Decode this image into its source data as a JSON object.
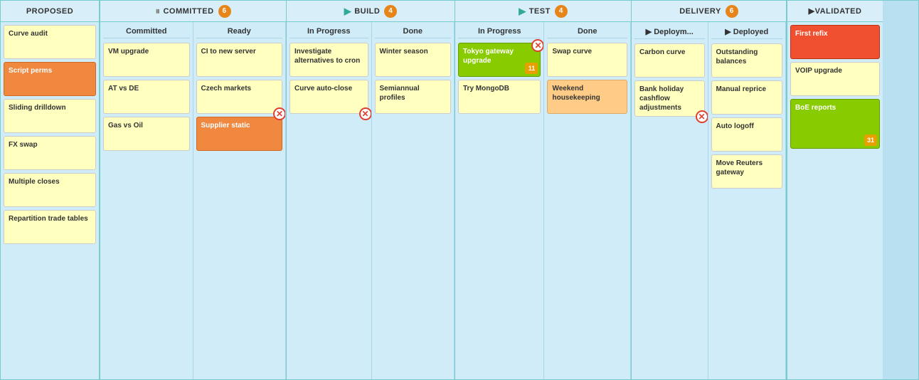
{
  "board": {
    "columns": [
      {
        "id": "proposed",
        "label": "PROPOSED",
        "type": "single",
        "width": 140,
        "cards": [
          {
            "title": "Curve audit",
            "color": "yellow"
          },
          {
            "title": "Script perms",
            "color": "orange"
          },
          {
            "title": "Sliding drilldown",
            "color": "yellow"
          },
          {
            "title": "FX swap",
            "color": "yellow"
          },
          {
            "title": "Multiple closes",
            "color": "yellow"
          },
          {
            "title": "Repartition trade tables",
            "color": "yellow"
          }
        ]
      },
      {
        "id": "committed",
        "label": "COMMITTED",
        "badge": "6",
        "pause": true,
        "lanes": [
          {
            "id": "committed-committed",
            "label": "Committed",
            "width": 130,
            "cards": [
              {
                "title": "VM upgrade",
                "color": "yellow"
              },
              {
                "title": "AT vs DE",
                "color": "yellow"
              },
              {
                "title": "Gas vs Oil",
                "color": "yellow"
              }
            ],
            "deleteBtn": false
          },
          {
            "id": "committed-ready",
            "label": "Ready",
            "width": 130,
            "cards": [
              {
                "title": "CI to new server",
                "color": "yellow"
              },
              {
                "title": "Czech markets",
                "color": "yellow"
              },
              {
                "title": "Supplier static",
                "color": "orange"
              }
            ],
            "deleteBtn": true
          }
        ]
      },
      {
        "id": "build",
        "label": "BUILD",
        "badge": "4",
        "arrow": true,
        "lanes": [
          {
            "id": "build-inprogress",
            "label": "In Progress",
            "width": 120,
            "cards": [
              {
                "title": "Investigate alternatives to cron",
                "color": "yellow"
              },
              {
                "title": "Curve auto-close",
                "color": "yellow"
              }
            ],
            "deleteBtn": true
          },
          {
            "id": "build-done",
            "label": "Done",
            "width": 115,
            "cards": [
              {
                "title": "Winter season",
                "color": "yellow"
              },
              {
                "title": "Semiannual profiles",
                "color": "yellow"
              }
            ],
            "deleteBtn": false
          }
        ]
      },
      {
        "id": "test",
        "label": "TEST",
        "badge": "4",
        "arrow": true,
        "lanes": [
          {
            "id": "test-inprogress",
            "label": "In Progress",
            "width": 125,
            "cards": [
              {
                "title": "Tokyo gateway upgrade",
                "color": "green",
                "badge": "11",
                "deleteBtn": true
              },
              {
                "title": "Try MongoDB",
                "color": "yellow"
              }
            ],
            "deleteBtn": false
          },
          {
            "id": "test-done",
            "label": "Done",
            "width": 120,
            "cards": [
              {
                "title": "Swap curve",
                "color": "yellow"
              },
              {
                "title": "Weekend housekeeping",
                "color": "light-orange"
              }
            ],
            "deleteBtn": false
          }
        ]
      },
      {
        "id": "delivery",
        "label": "DELIVERY",
        "badge": "6",
        "arrow": true,
        "lanes": [
          {
            "id": "delivery-deploym",
            "label": "Deploym...",
            "width": 105,
            "cards": [
              {
                "title": "Carbon curve",
                "color": "yellow"
              },
              {
                "title": "Bank holiday cashflow adjustments",
                "color": "yellow"
              }
            ],
            "deleteBtn": true
          },
          {
            "id": "delivery-deployed",
            "label": "Deployed",
            "width": 110,
            "arrow": true,
            "cards": [
              {
                "title": "Outstanding balances",
                "color": "yellow"
              },
              {
                "title": "Manual reprice",
                "color": "yellow"
              },
              {
                "title": "Auto logoff",
                "color": "yellow"
              },
              {
                "title": "Move Reuters gateway",
                "color": "yellow"
              }
            ],
            "deleteBtn": false
          }
        ]
      },
      {
        "id": "validated",
        "label": "VALIDATED",
        "arrow": true,
        "cards": [
          {
            "title": "First refix",
            "color": "red"
          },
          {
            "title": "VOIP upgrade",
            "color": "yellow"
          },
          {
            "title": "BoE reports",
            "color": "green",
            "badge": "31"
          }
        ]
      }
    ]
  }
}
